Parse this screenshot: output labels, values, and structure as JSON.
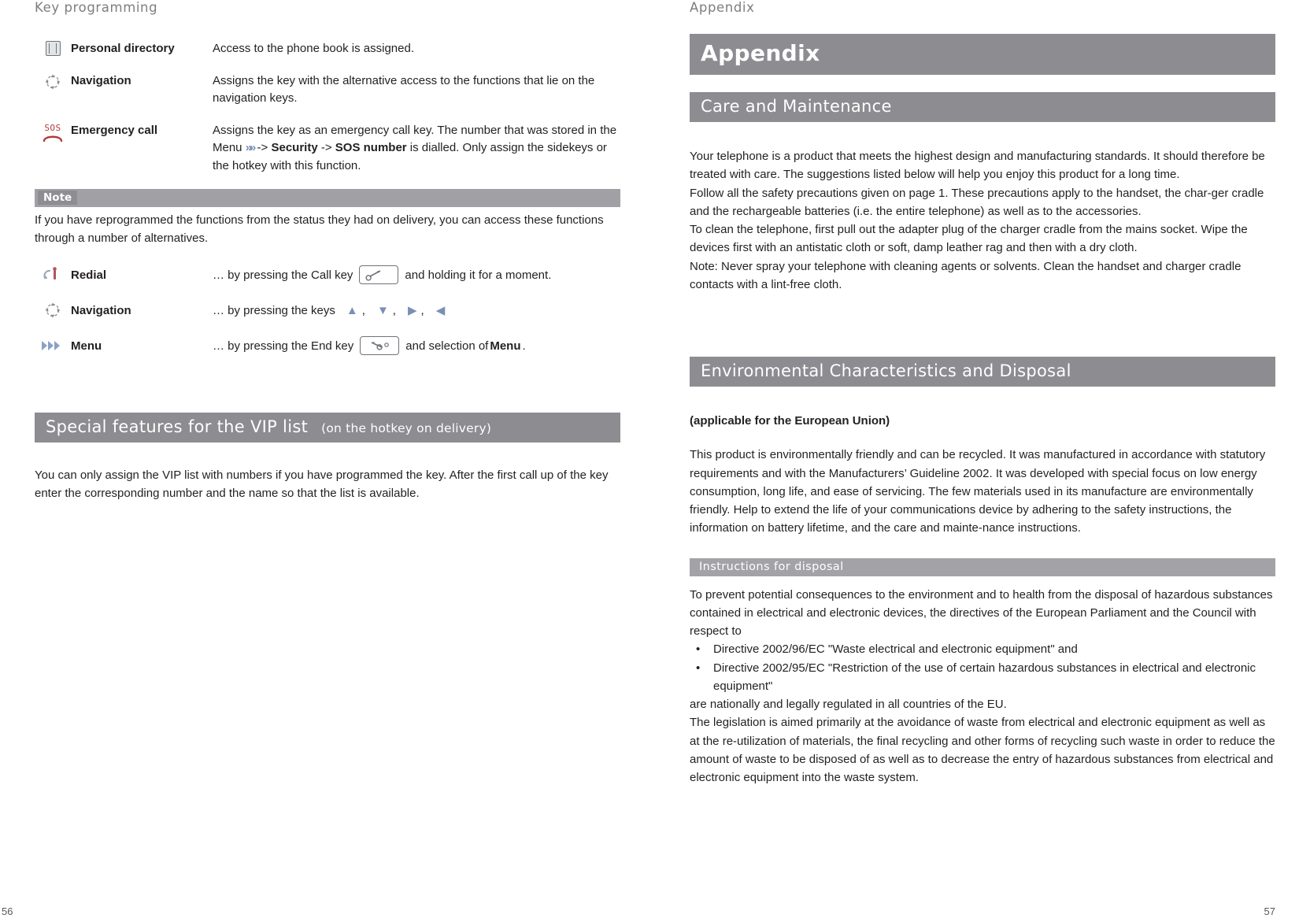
{
  "left_page": {
    "running_head": "Key programming",
    "page_number": "56",
    "key_rows": [
      {
        "icon": "phonebook-icon",
        "label": "Personal directory",
        "desc": "Access to the phone book is assigned."
      },
      {
        "icon": "navigation-key-icon",
        "label": "Navigation",
        "desc": "Assigns the key with the alternative access to the functions that lie on the navigation keys."
      },
      {
        "icon": "sos-emergency-icon",
        "label": "Emergency call",
        "desc_parts": {
          "p1": "Assigns the key as an emergency call key. The number that was stored in the Menu ",
          "menu_glyph": "»»",
          "p2": " -> ",
          "b1": "Security",
          "p3": " -> ",
          "b2": "SOS number",
          "p4": " is dialled. Only assign the sidekeys or the hotkey with this function."
        }
      }
    ],
    "note": {
      "title": "Note",
      "text": "If you have reprogrammed the functions from the status they had on delivery, you can access these functions through a number of alternatives."
    },
    "alt_rows": [
      {
        "icon": "redial-icon",
        "label": "Redial",
        "pre": "… by pressing the Call key",
        "key": "call-key",
        "post": "and holding it for a moment."
      },
      {
        "icon": "navigation-key-icon",
        "label": "Navigation",
        "pre": "… by pressing the keys",
        "arrows": [
          "▲",
          ",",
          "▼",
          ",",
          "▶",
          ",",
          "◀"
        ],
        "post": ""
      },
      {
        "icon": "menu-chevrons-icon",
        "label": "Menu",
        "pre": "… by pressing the End key",
        "key": "end-key",
        "post": "and selection of ",
        "post_bold": "Menu",
        "post_end": "."
      }
    ],
    "vip_section": {
      "title": "Special features for the VIP list",
      "subtitle": "(on the hotkey on delivery)",
      "text": "You can only assign the VIP list with numbers if you have programmed the key. After the first call up of the key enter the corresponding number and the name so that the list is available."
    }
  },
  "right_page": {
    "running_head": "Appendix",
    "page_number": "57",
    "title_bar": "Appendix",
    "care_section": {
      "title": "Care and Maintenance",
      "paragraphs": [
        "Your telephone is a product that meets the highest design and manufacturing standards. It should therefore be treated with care. The suggestions listed below will help you enjoy this product for a long time.",
        "Follow all the safety precautions given on page 1. These precautions apply to the handset, the char-ger cradle and the rechargeable batteries (i.e. the entire telephone) as well as to the accessories.",
        "To clean the telephone, first pull out the adapter plug of the charger cradle from the mains socket. Wipe the devices first with an antistatic cloth or soft, damp leather rag and then with a dry cloth.",
        "Note: Never spray your telephone with cleaning agents or solvents. Clean the handset and charger cradle contacts with a lint-free cloth."
      ]
    },
    "env_section": {
      "title": "Environmental Characteristics and Disposal",
      "applicable": "(applicable for the European Union)",
      "paragraph": "This product is environmentally friendly and can be recycled. It was manufactured in accordance with statutory requirements and with the Manufacturers’ Guideline 2002. It was developed with special focus on low energy consumption, long life, and ease of servicing. The few materials used in its manufacture are environmentally friendly. Help to extend the life of your communications device by adhering to the safety instructions, the information on battery lifetime, and the care and mainte-nance instructions.",
      "disposal_header": "Instructions for disposal",
      "disposal_intro": "To prevent potential consequences to the environment and to health from the disposal of hazardous substances contained in electrical and electronic devices, the directives of the European Parliament and the Council with respect to",
      "bullets": [
        "Directive 2002/96/EC \"Waste electrical and electronic equipment\" and",
        "Directive 2002/95/EC \"Restriction of the use of certain hazardous substances in electrical and electronic equipment\""
      ],
      "after_bullets": [
        "are nationally and legally regulated in all countries of the EU.",
        "The legislation is aimed primarily at the avoidance of waste from electrical and electronic equipment as well as at the re-utilization of materials, the final recycling and other forms of recycling such waste in order to reduce the amount of waste to be disposed of as well as to decrease the entry of hazardous substances from electrical and electronic equipment into the waste system."
      ]
    }
  }
}
